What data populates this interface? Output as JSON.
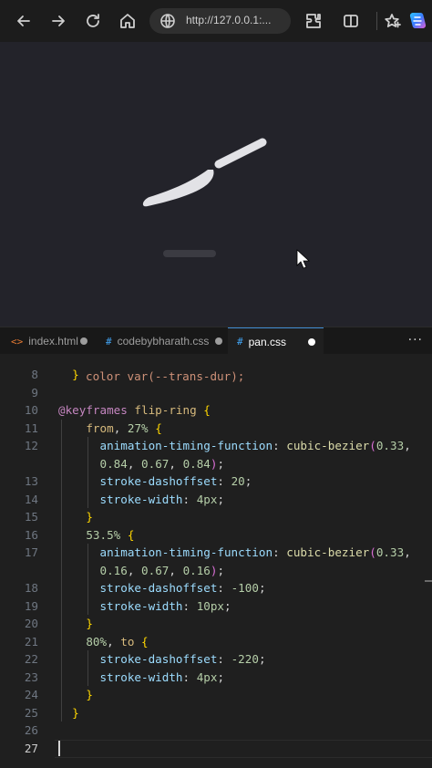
{
  "browser": {
    "url": "http://127.0.0.1:...",
    "icons": [
      "back-arrow-icon",
      "forward-arrow-icon",
      "refresh-icon",
      "home-icon",
      "globe-icon",
      "extensions-icon",
      "split-screen-icon",
      "favorites-icon",
      "copilot-icon"
    ]
  },
  "preview": {
    "background": "#23232a",
    "shape_color": "#e2e2e6"
  },
  "editor": {
    "tabs": [
      {
        "label": "index.html",
        "icon": "<>",
        "icon_color": "#e37933",
        "modified": true,
        "active": false
      },
      {
        "label": "codebybharath.css",
        "icon": "#",
        "icon_color": "#42a5f5",
        "modified": true,
        "active": false
      },
      {
        "label": "pan.css",
        "icon": "#",
        "icon_color": "#42a5f5",
        "modified": true,
        "active": true
      }
    ],
    "more_label": "···",
    "partial_line": "color var(--trans-dur);",
    "lines": [
      {
        "n": "8",
        "text": "  }"
      },
      {
        "n": "9",
        "text": ""
      },
      {
        "n": "10",
        "text": "@keyframes flip-ring {"
      },
      {
        "n": "11",
        "text": "    from, 27% {"
      },
      {
        "n": "12",
        "text": "      animation-timing-function: cubic-bezier(0.33,"
      },
      {
        "n": "",
        "text": "      0.84, 0.67, 0.84);"
      },
      {
        "n": "13",
        "text": "      stroke-dashoffset: 20;"
      },
      {
        "n": "14",
        "text": "      stroke-width: 4px;"
      },
      {
        "n": "15",
        "text": "    }"
      },
      {
        "n": "16",
        "text": "    53.5% {"
      },
      {
        "n": "17",
        "text": "      animation-timing-function: cubic-bezier(0.33,"
      },
      {
        "n": "",
        "text": "      0.16, 0.67, 0.16);"
      },
      {
        "n": "18",
        "text": "      stroke-dashoffset: -100;"
      },
      {
        "n": "19",
        "text": "      stroke-width: 10px;"
      },
      {
        "n": "20",
        "text": "    }"
      },
      {
        "n": "21",
        "text": "    80%, to {"
      },
      {
        "n": "22",
        "text": "      stroke-dashoffset: -220;"
      },
      {
        "n": "23",
        "text": "      stroke-width: 4px;"
      },
      {
        "n": "24",
        "text": "    }"
      },
      {
        "n": "25",
        "text": "  }"
      },
      {
        "n": "26",
        "text": ""
      },
      {
        "n": "27",
        "text": ""
      }
    ],
    "current_line": "27"
  }
}
